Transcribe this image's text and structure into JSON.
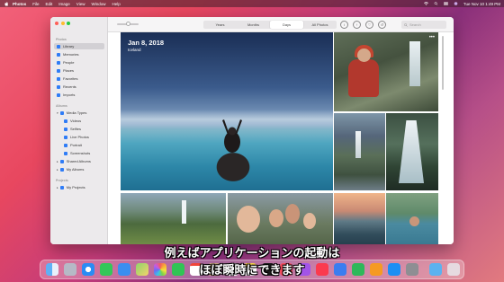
{
  "menubar": {
    "app_name": "Photos",
    "menus": [
      "File",
      "Edit",
      "Image",
      "View",
      "Window",
      "Help"
    ],
    "clock": "Tue Nov 10  1:49 PM"
  },
  "sidebar": {
    "section_photos": "Photos",
    "library": "Library",
    "memories": "Memories",
    "people": "People",
    "places": "Places",
    "favorites": "Favorites",
    "recents": "Recents",
    "imports": "Imports",
    "section_albums": "Albums",
    "media_types": "Media Types",
    "videos": "Videos",
    "selfies": "Selfies",
    "live_photos": "Live Photos",
    "portrait": "Portrait",
    "screenshots": "Screenshots",
    "shared_albums": "Shared Albums",
    "my_albums": "My Albums",
    "section_projects": "Projects",
    "my_projects": "My Projects"
  },
  "toolbar": {
    "tabs": [
      "Years",
      "Months",
      "Days",
      "All Photos"
    ],
    "active_tab": "Days",
    "search_placeholder": "Search"
  },
  "grid": {
    "date": "Jan 8, 2018",
    "location": "Iceland"
  },
  "subtitles": {
    "line1": "例えばアプリケーションの起動は",
    "line2": "ほぼ瞬時にできます"
  },
  "dock": {
    "icons": [
      "finder-icon",
      "launchpad-icon",
      "safari-icon",
      "messages-icon",
      "mail-icon",
      "maps-icon",
      "photos-icon",
      "facetime-icon",
      "calendar-icon",
      "contacts-icon",
      "reminders-icon",
      "notes-icon",
      "tv-icon",
      "music-icon",
      "podcasts-icon",
      "news-icon",
      "keynote-icon",
      "numbers-icon",
      "pages-icon",
      "app-store-icon",
      "system-preferences-icon",
      "downloads-icon",
      "trash-icon"
    ]
  }
}
